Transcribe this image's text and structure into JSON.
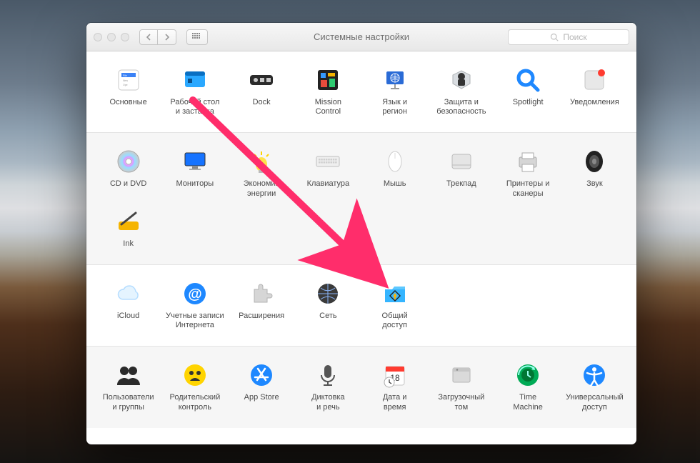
{
  "titlebar": {
    "title": "Системные настройки",
    "search_placeholder": "Поиск"
  },
  "sections": [
    {
      "alt": false,
      "items": [
        {
          "id": "general",
          "label": "Основные"
        },
        {
          "id": "desktop",
          "label": "Рабочий стол\nи заставка"
        },
        {
          "id": "dock",
          "label": "Dock"
        },
        {
          "id": "mission",
          "label": "Mission\nControl"
        },
        {
          "id": "lang",
          "label": "Язык и\nрегион"
        },
        {
          "id": "security",
          "label": "Защита и\nбезопасность"
        },
        {
          "id": "spotlight",
          "label": "Spotlight"
        },
        {
          "id": "notifications",
          "label": "Уведомления"
        }
      ]
    },
    {
      "alt": true,
      "items": [
        {
          "id": "cddvd",
          "label": "CD и DVD"
        },
        {
          "id": "displays",
          "label": "Мониторы"
        },
        {
          "id": "energy",
          "label": "Экономия\nэнергии"
        },
        {
          "id": "keyboard",
          "label": "Клавиатура"
        },
        {
          "id": "mouse",
          "label": "Мышь"
        },
        {
          "id": "trackpad",
          "label": "Трекпад"
        },
        {
          "id": "printers",
          "label": "Принтеры и\nсканеры"
        },
        {
          "id": "sound",
          "label": "Звук"
        },
        {
          "id": "ink",
          "label": "Ink"
        }
      ]
    },
    {
      "alt": false,
      "items": [
        {
          "id": "icloud",
          "label": "iCloud"
        },
        {
          "id": "internet",
          "label": "Учетные записи\nИнтернета"
        },
        {
          "id": "extensions",
          "label": "Расширения"
        },
        {
          "id": "network",
          "label": "Сеть"
        },
        {
          "id": "sharing",
          "label": "Общий\nдоступ"
        }
      ]
    },
    {
      "alt": true,
      "items": [
        {
          "id": "users",
          "label": "Пользователи\nи группы"
        },
        {
          "id": "parental",
          "label": "Родительский\nконтроль"
        },
        {
          "id": "appstore",
          "label": "App Store"
        },
        {
          "id": "dictation",
          "label": "Диктовка\nи речь"
        },
        {
          "id": "datetime",
          "label": "Дата и\nвремя"
        },
        {
          "id": "startup",
          "label": "Загрузочный\nтом"
        },
        {
          "id": "timemachine",
          "label": "Time\nMachine"
        },
        {
          "id": "accessibility",
          "label": "Универсальный\nдоступ"
        }
      ]
    }
  ],
  "arrow": {
    "from_item": "desktop",
    "to_item": "sharing",
    "color": "#ff2d6b"
  }
}
